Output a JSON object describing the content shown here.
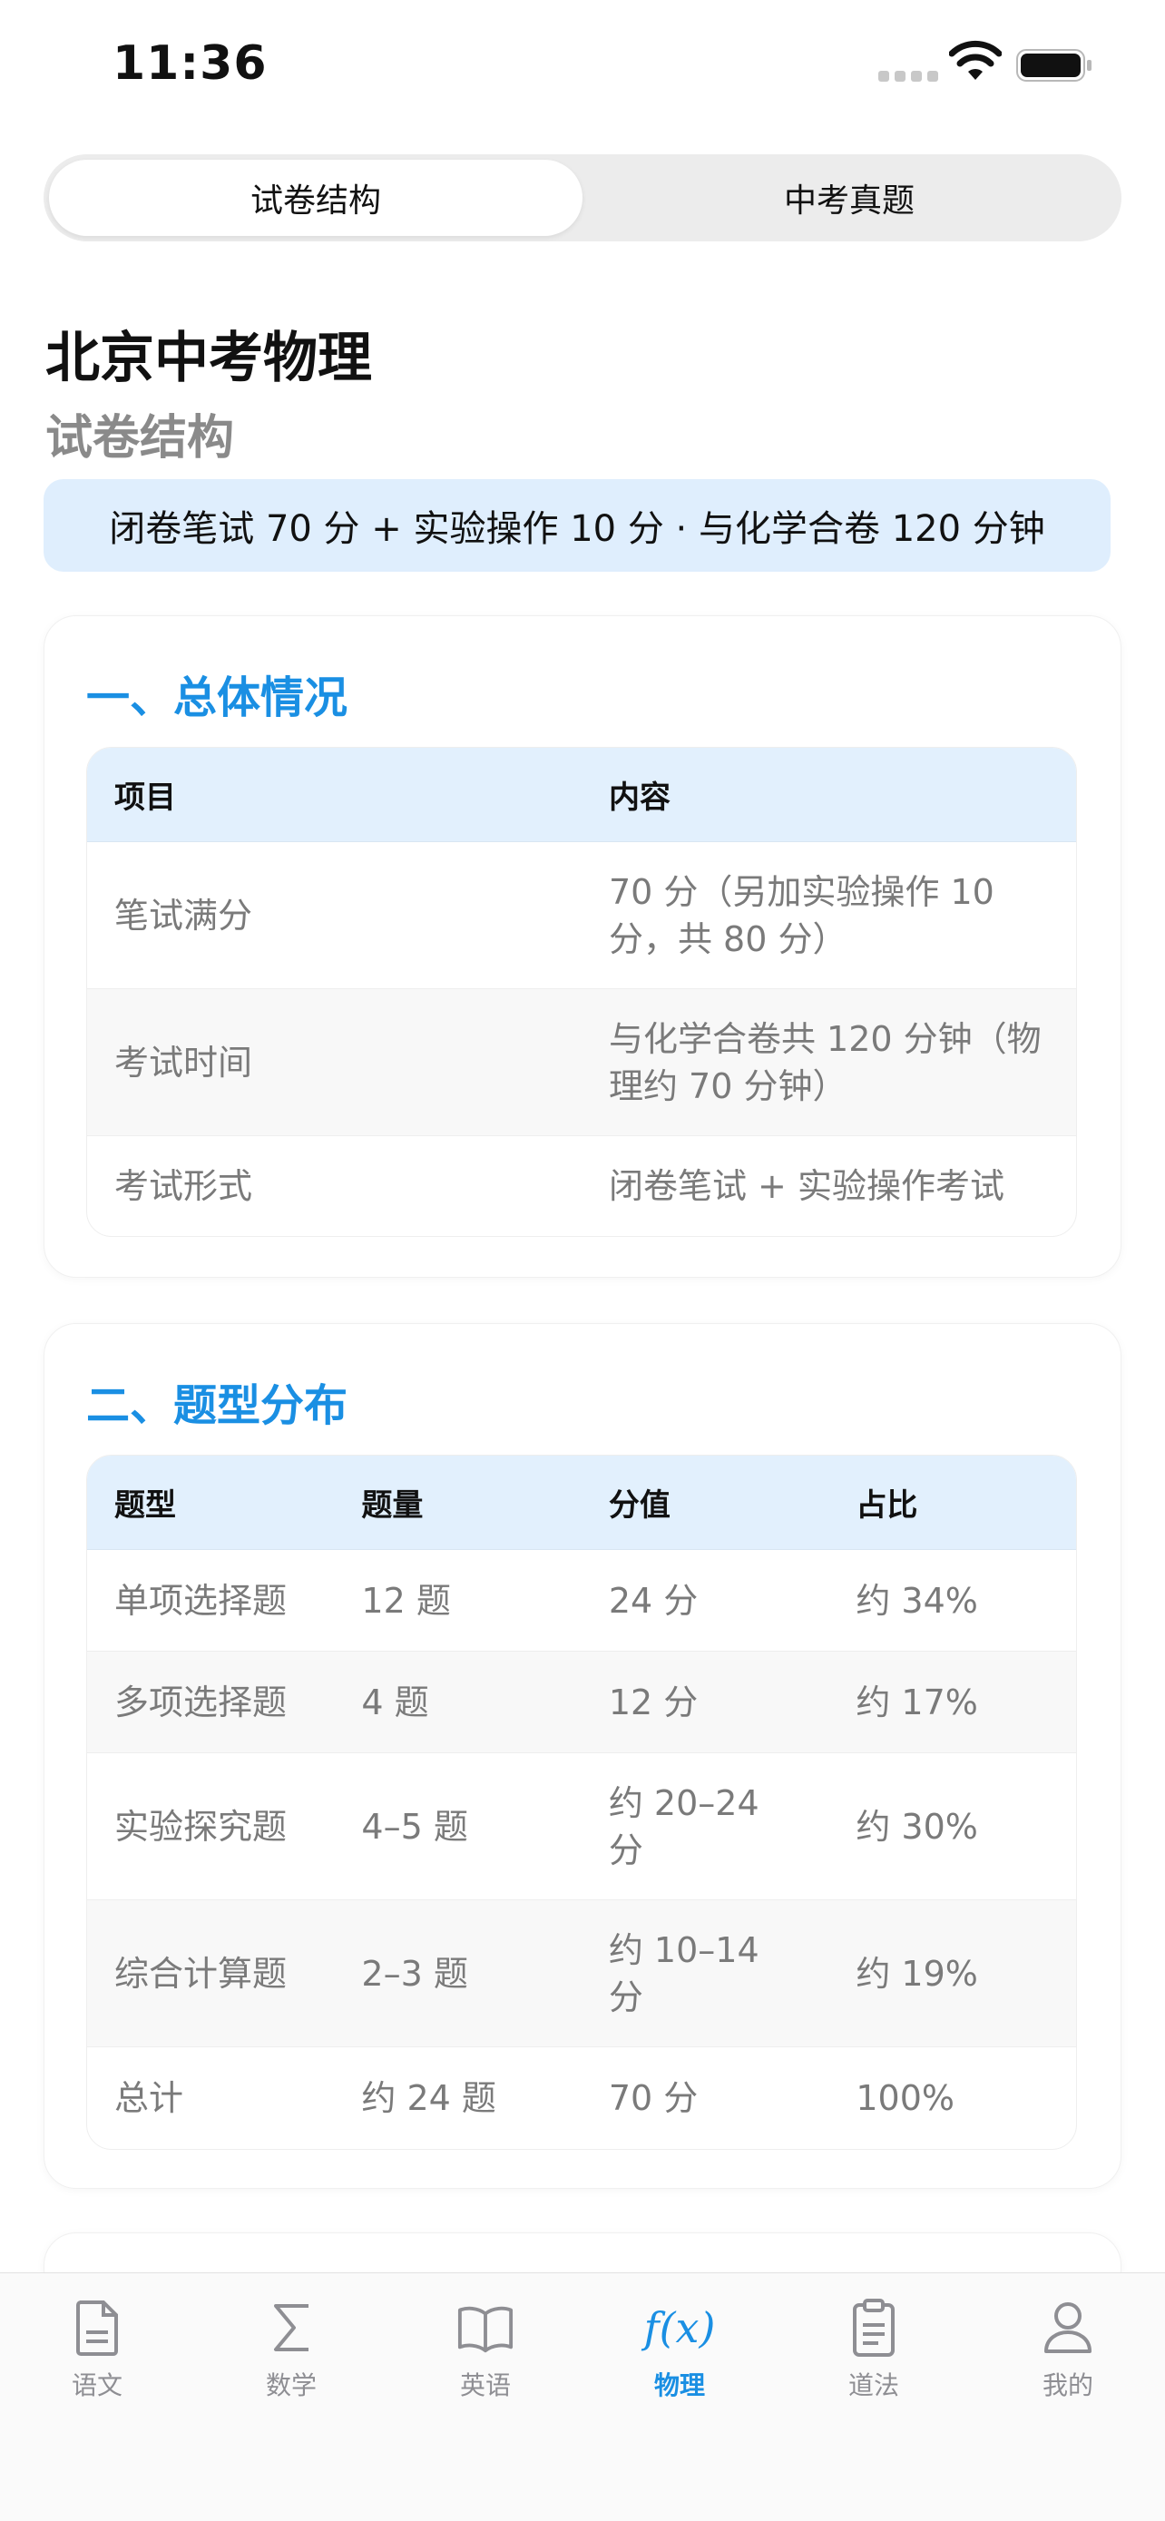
{
  "status_bar": {
    "time": "11:36"
  },
  "segmented": {
    "tabs": [
      "试卷结构",
      "中考真题"
    ],
    "active": 0
  },
  "header": {
    "title": "北京中考物理",
    "subtitle": "试卷结构",
    "banner": "闭卷笔试 70 分 + 实验操作 10 分 · 与化学合卷 120 分钟"
  },
  "section1": {
    "title": "一、总体情况",
    "headers": [
      "项目",
      "内容"
    ],
    "rows": [
      [
        "笔试满分",
        "70 分（另加实验操作 10 分，共 80 分）"
      ],
      [
        "考试时间",
        "与化学合卷共 120 分钟（物理约 70 分钟）"
      ],
      [
        "考试形式",
        "闭卷笔试 + 实验操作考试"
      ]
    ]
  },
  "section2": {
    "title": "二、题型分布",
    "headers": [
      "题型",
      "题量",
      "分值",
      "占比"
    ],
    "rows": [
      [
        "单项选择题",
        "12 题",
        "24 分",
        "约 34%"
      ],
      [
        "多项选择题",
        "4 题",
        "12 分",
        "约 17%"
      ],
      [
        "实验探究题",
        "4–5 题",
        "约 20–24 分",
        "约 30%"
      ],
      [
        "综合计算题",
        "2–3 题",
        "约 10–14 分",
        "约 19%"
      ],
      [
        "总计",
        "约 24 题",
        "70 分",
        "100%"
      ]
    ]
  },
  "tab_bar": {
    "items": [
      {
        "label": "语文",
        "icon": "document-icon"
      },
      {
        "label": "数学",
        "icon": "sigma-icon"
      },
      {
        "label": "英语",
        "icon": "book-icon"
      },
      {
        "label": "物理",
        "icon": "function-icon",
        "icon_text": "f(x)"
      },
      {
        "label": "道法",
        "icon": "clipboard-icon"
      },
      {
        "label": "我的",
        "icon": "person-icon"
      }
    ],
    "active": 3
  },
  "colors": {
    "accent": "#1a8fe3",
    "banner_bg": "#dfeefd",
    "header_bg": "#e2f0fd"
  }
}
